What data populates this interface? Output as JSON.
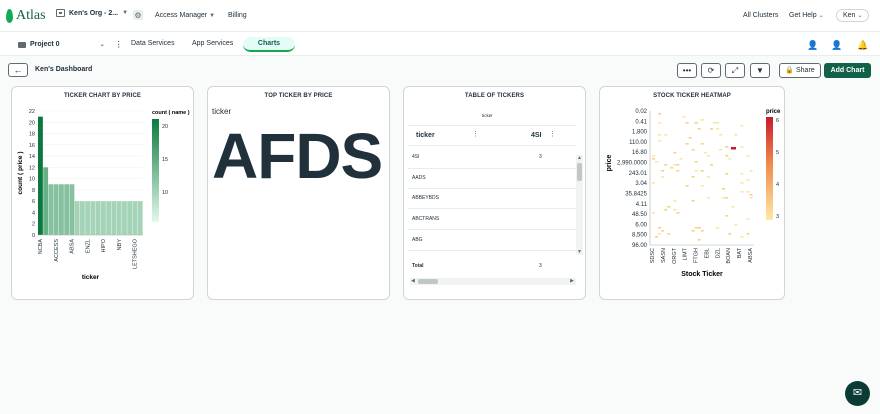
{
  "topbar": {
    "brand": "Atlas",
    "org_name": "Ken's Org - 2...",
    "access_manager": "Access Manager",
    "billing": "Billing",
    "all_clusters": "All Clusters",
    "get_help": "Get Help",
    "user": "Ken"
  },
  "project_bar": {
    "project": "Project 0",
    "tabs": [
      "Data Services",
      "App Services",
      "Charts"
    ],
    "active_tab": "Charts"
  },
  "dashboard": {
    "title": "Ken's Dashboard",
    "share_label": "Share",
    "add_chart_label": "Add Chart"
  },
  "chart_data": [
    {
      "type": "bar",
      "title": "TICKER CHART BY PRICE",
      "xlabel": "ticker",
      "ylabel": "count ( price )",
      "ylim": [
        0,
        22
      ],
      "yticks": [
        "0",
        "2",
        "4",
        "6",
        "8",
        "10",
        "12",
        "14",
        "16",
        "18",
        "20",
        "22"
      ],
      "tick_labels": [
        "NCBA",
        "ACCESS",
        "ABSA",
        "ENZL",
        "HIPO",
        "NBY",
        "LETSHEGO"
      ],
      "values": [
        21,
        12,
        9,
        9,
        9,
        9,
        9,
        6,
        6,
        6,
        6,
        6,
        6,
        6,
        6,
        6,
        6,
        6,
        6,
        6
      ],
      "legend_title": "count ( name )",
      "legend_ticks": [
        "20",
        "15",
        "10"
      ]
    },
    {
      "type": "heatmap",
      "title": "STOCK TICKER HEATMAP",
      "xlabel": "Stock Ticker",
      "ylabel": "price",
      "y_tick_labels": [
        "0.02",
        "0.41",
        "1,800",
        "110.00",
        "16.80",
        "2,990.0000",
        "243.01",
        "3.04",
        "35.8425",
        "4.11",
        "48.50",
        "6.00",
        "8,500",
        "96.00"
      ],
      "x_tick_labels": [
        "SDSC",
        "SASN",
        "ORGT",
        "LIMT",
        "FTGH",
        "EBL",
        "DZL",
        "BOAN",
        "BAT",
        "ABSA"
      ],
      "legend_title": "price",
      "legend_ticks": [
        "6",
        "5",
        "4",
        "3"
      ]
    }
  ],
  "top_ticker": {
    "title": "TOP TICKER BY PRICE",
    "label": "ticker",
    "value": "AFDS"
  },
  "table": {
    "title": "TABLE OF TICKERS",
    "group_header": "ticker",
    "col1": "ticker",
    "col2": "4SI",
    "rows": [
      {
        "ticker": "4SI",
        "value": "3"
      },
      {
        "ticker": "AADS",
        "value": ""
      },
      {
        "ticker": "ABBEYBDS",
        "value": ""
      },
      {
        "ticker": "ABCTRANS",
        "value": ""
      },
      {
        "ticker": "ABG",
        "value": ""
      }
    ],
    "total_label": "Total",
    "total_value": "3"
  },
  "colors": {
    "brand": "#13aa52",
    "dark_green": "#116149",
    "heat_low": "#fde9a8",
    "heat_high": "#c9192e"
  }
}
